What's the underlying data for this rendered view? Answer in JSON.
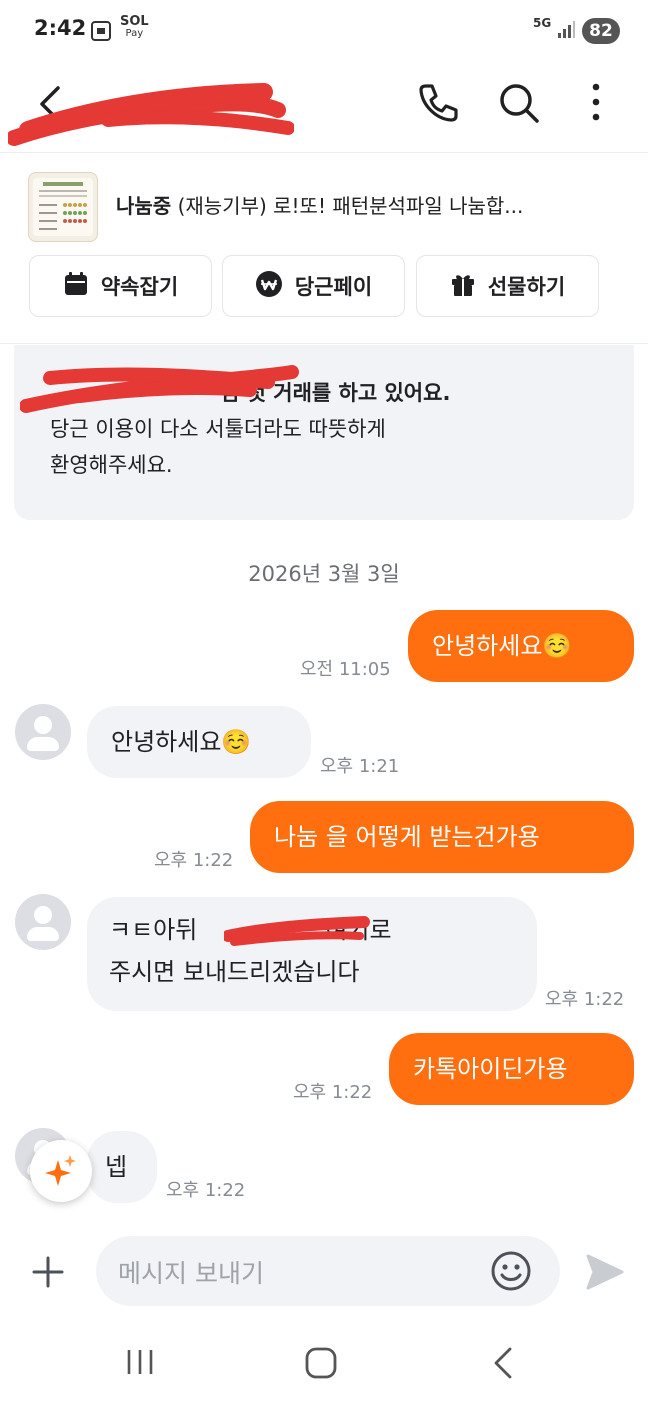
{
  "status_bar": {
    "time": "2:42",
    "sol_label": "SOL",
    "pay_label": "Pay",
    "network": "5G",
    "battery": "82"
  },
  "product": {
    "status": "나눔중",
    "title": "(재능기부) 로!또! 패턴분석파일 나눔합..."
  },
  "actions": [
    {
      "label": "약속잡기",
      "icon": "calendar-icon"
    },
    {
      "label": "당근페이",
      "icon": "daangn-pay-icon"
    },
    {
      "label": "선물하기",
      "icon": "gift-icon"
    }
  ],
  "notice": {
    "line1_visible": "님 첫 거래를 하고 있어요.",
    "line2": "당근 이용이 다소 서툴더라도 따뜻하게",
    "line3": "환영해주세요."
  },
  "date_divider": "2026년 3월 3일",
  "messages": [
    {
      "dir": "out",
      "text": "안녕하세요☺️",
      "time": "오전 11:05"
    },
    {
      "dir": "in",
      "text": "안녕하세요☺️",
      "time": "오후 1:21"
    },
    {
      "dir": "out",
      "text": "나눔 을 어떻게 받는건가용",
      "time": "오후 1:22"
    },
    {
      "dir": "in",
      "line1": "ㅋㅌ아뒤",
      "line1_tail": "여기로",
      "line2": "주시면 보내드리겠습니다",
      "time": "오후 1:22"
    },
    {
      "dir": "out",
      "text": "카톡아이딘가용",
      "time": "오후 1:22"
    },
    {
      "dir": "in",
      "text": "넵",
      "time": "오후 1:22"
    }
  ],
  "composer": {
    "placeholder": "메시지 보내기"
  },
  "colors": {
    "accent": "#ff6f0f",
    "bubble_in": "#f2f3f6",
    "redaction": "#e53935"
  }
}
